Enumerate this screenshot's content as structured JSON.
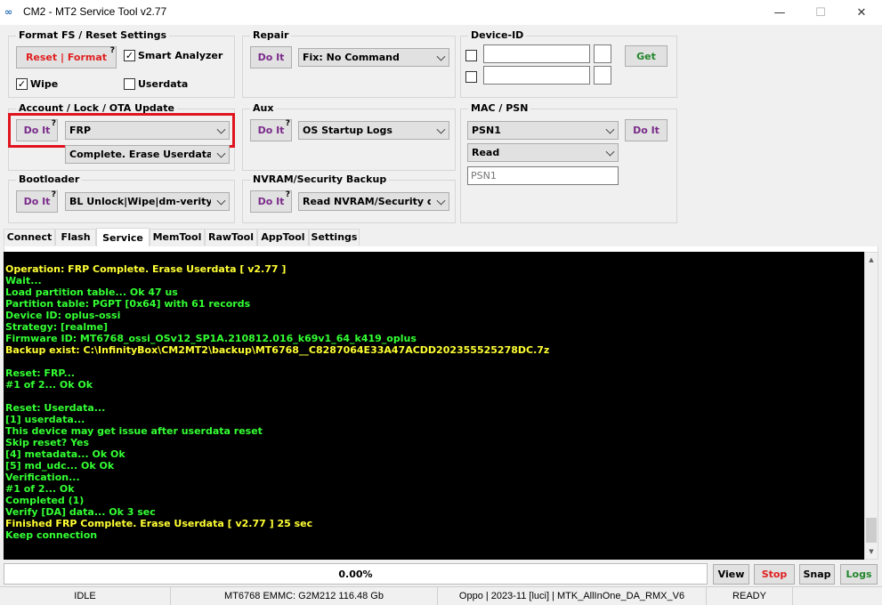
{
  "window": {
    "icon_text": "∞",
    "title": "CM2 - MT2 Service Tool v2.77",
    "minimize": "—",
    "maximize": "☐",
    "close": "✕"
  },
  "format_fs": {
    "title": "Format FS / Reset Settings",
    "reset_button": "Reset | Format",
    "help": "?",
    "smart_analyzer": {
      "label": "Smart Analyzer",
      "checked": "✓"
    },
    "wipe": {
      "label": "Wipe",
      "checked": "✓"
    },
    "userdata": {
      "label": "Userdata",
      "checked": ""
    }
  },
  "repair": {
    "title": "Repair",
    "do_it": "Do It",
    "selected": "Fix: No Command"
  },
  "device_id": {
    "title": "Device-ID",
    "get_button": "Get"
  },
  "account": {
    "title": "Account / Lock / OTA Update",
    "do_it": "Do It",
    "help": "?",
    "selected": "FRP",
    "sub_selected": "Complete. Erase Userdata"
  },
  "aux": {
    "title": "Aux",
    "do_it": "Do It",
    "help": "?",
    "selected": "OS Startup Logs"
  },
  "mac_psn": {
    "title": "MAC / PSN",
    "do_it": "Do It",
    "selected": "PSN1",
    "mode": "Read",
    "field_placeholder": "PSN1"
  },
  "bootloader": {
    "title": "Bootloader",
    "do_it": "Do It",
    "help": "?",
    "selected": "BL Unlock|Wipe|dm-verity Off"
  },
  "nvram": {
    "title": "NVRAM/Security Backup",
    "do_it": "Do It",
    "help": "?",
    "selected": "Read NVRAM/Security data"
  },
  "tabs": [
    {
      "label": "Connect"
    },
    {
      "label": "Flash"
    },
    {
      "label": "Service"
    },
    {
      "label": "MemTool"
    },
    {
      "label": "RawTool"
    },
    {
      "label": "AppTool"
    },
    {
      "label": "Settings"
    }
  ],
  "console": {
    "colors": {
      "yellow": "#ffff33",
      "green": "#33ff33"
    },
    "lines": [
      {
        "text": "Operation: FRP Complete. Erase Userdata [ v2.77 ]",
        "color": "yellow"
      },
      {
        "text": "Wait...",
        "color": "green"
      },
      {
        "text": "Load partition table... Ok 47 us",
        "color": "green"
      },
      {
        "text": "Partition table: PGPT [0x64] with 61 records",
        "color": "green"
      },
      {
        "text": "Device ID: oplus-ossi",
        "color": "green"
      },
      {
        "text": "Strategy: [realme]",
        "color": "green"
      },
      {
        "text": "Firmware ID: MT6768_ossi_OSv12_SP1A.210812.016_k69v1_64_k419_oplus",
        "color": "green"
      },
      {
        "text": "Backup exist: C:\\InfinityBox\\CM2MT2\\backup\\MT6768__C8287064E33A47ACDD202355525278DC.7z",
        "color": "yellow"
      },
      {
        "text": "",
        "color": "green"
      },
      {
        "text": "Reset: FRP...",
        "color": "green"
      },
      {
        "text": "#1 of 2... Ok Ok",
        "color": "green"
      },
      {
        "text": "",
        "color": "green"
      },
      {
        "text": "Reset: Userdata...",
        "color": "green"
      },
      {
        "text": "[1] userdata...",
        "color": "green"
      },
      {
        "text": "This device may get issue after userdata reset",
        "color": "green"
      },
      {
        "text": "Skip reset? Yes",
        "color": "green"
      },
      {
        "text": "[4] metadata... Ok Ok",
        "color": "green"
      },
      {
        "text": "[5] md_udc... Ok Ok",
        "color": "green"
      },
      {
        "text": "Verification...",
        "color": "green"
      },
      {
        "text": "#1 of 2... Ok",
        "color": "green"
      },
      {
        "text": "Completed (1)",
        "color": "green"
      },
      {
        "text": "Verify [DA] data... Ok 3 sec",
        "color": "green"
      },
      {
        "text": "Finished FRP Complete. Erase Userdata [ v2.77 ] 25 sec",
        "color": "yellow"
      },
      {
        "text": "Keep connection",
        "color": "green"
      }
    ]
  },
  "progress": {
    "label": "0.00%",
    "fraction": 0.0
  },
  "buttons": {
    "view": "View",
    "stop": "Stop",
    "snap": "Snap",
    "logs": "Logs"
  },
  "statusbar": {
    "state": "IDLE",
    "storage": "MT6768 EMMC: G2M212 116.48 Gb",
    "device": "Oppo | 2023-11 [luci] | MTK_AllInOne_DA_RMX_V6",
    "ready": "READY"
  }
}
